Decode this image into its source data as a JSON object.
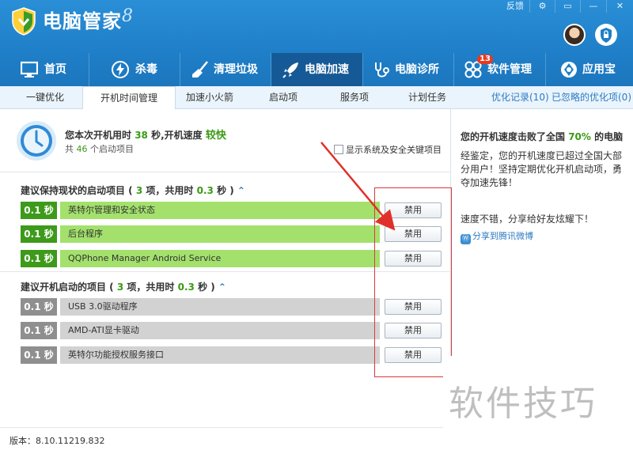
{
  "app": {
    "title": "电脑管家",
    "title_mark": "8",
    "controls": [
      "反馈",
      "⚙",
      "▭",
      "—",
      "✕"
    ]
  },
  "nav": {
    "items": [
      {
        "label": "首页",
        "icon": "monitor-icon"
      },
      {
        "label": "杀毒",
        "icon": "lightning-icon"
      },
      {
        "label": "清理垃圾",
        "icon": "broom-icon"
      },
      {
        "label": "电脑加速",
        "icon": "rocket-icon",
        "active": true
      },
      {
        "label": "电脑诊所",
        "icon": "stethoscope-icon"
      },
      {
        "label": "软件管理",
        "icon": "software-icon",
        "badge": "13"
      },
      {
        "label": "应用宝",
        "icon": "app-store-icon"
      }
    ]
  },
  "subnav": {
    "items": [
      "一键优化",
      "开机时间管理",
      "加速小火箭",
      "启动项",
      "服务项",
      "计划任务"
    ],
    "active_index": 1,
    "links": [
      "优化记录(10)",
      "已忽略的优化项(0)"
    ]
  },
  "summary": {
    "line1_pre": "您本次开机用时",
    "seconds": "38",
    "line1_mid": "秒,开机速度",
    "speed": "较快",
    "line2_pre": "共",
    "count": "46",
    "line2_post": "个启动项目",
    "checkbox_label": "显示系统及安全关键项目"
  },
  "sections": [
    {
      "title_pre": "建议保持现状的启动项目 (",
      "count": "3",
      "title_mid": "项，共用时",
      "time": "0.3",
      "title_post": "秒 )",
      "chevron": "⌃",
      "items": [
        {
          "time": "0.1 秒",
          "name": "英特尔管理和安全状态",
          "button": "禁用"
        },
        {
          "time": "0.1 秒",
          "name": "后台程序",
          "button": "禁用"
        },
        {
          "time": "0.1 秒",
          "name": "QQPhone Manager Android Service",
          "button": "禁用"
        }
      ]
    },
    {
      "title_pre": "建议开机启动的项目 (",
      "count": "3",
      "title_mid": "项，共用时",
      "time": "0.3",
      "title_post": "秒 )",
      "chevron": "⌃",
      "items": [
        {
          "time": "0.1 秒",
          "name": "USB 3.0驱动程序",
          "button": "禁用"
        },
        {
          "time": "0.1 秒",
          "name": "AMD-ATI显卡驱动",
          "button": "禁用"
        },
        {
          "time": "0.1 秒",
          "name": "英特尔功能授权服务接口",
          "button": "禁用"
        }
      ]
    }
  ],
  "right": {
    "title_pre": "您的开机速度击败了全国",
    "percent": "70%",
    "title_post": "的电脑",
    "desc": "经鉴定，您的开机速度已超过全国大部分用户！坚持定期优化开机启动项，勇夺加速先锋！",
    "share": "速度不错，分享给好友炫耀下！",
    "weibo": "分享到腾讯微博"
  },
  "footer": {
    "version": "版本：8.10.11219.832"
  },
  "watermark": "软件技巧",
  "colors": {
    "header": "#1f7fc8",
    "green_tag": "#3d9a1a",
    "green_bar": "#a3e16c",
    "gray_tag": "#8f8f8f",
    "gray_bar": "#d2d2d2",
    "annotation": "#d93a3a"
  }
}
